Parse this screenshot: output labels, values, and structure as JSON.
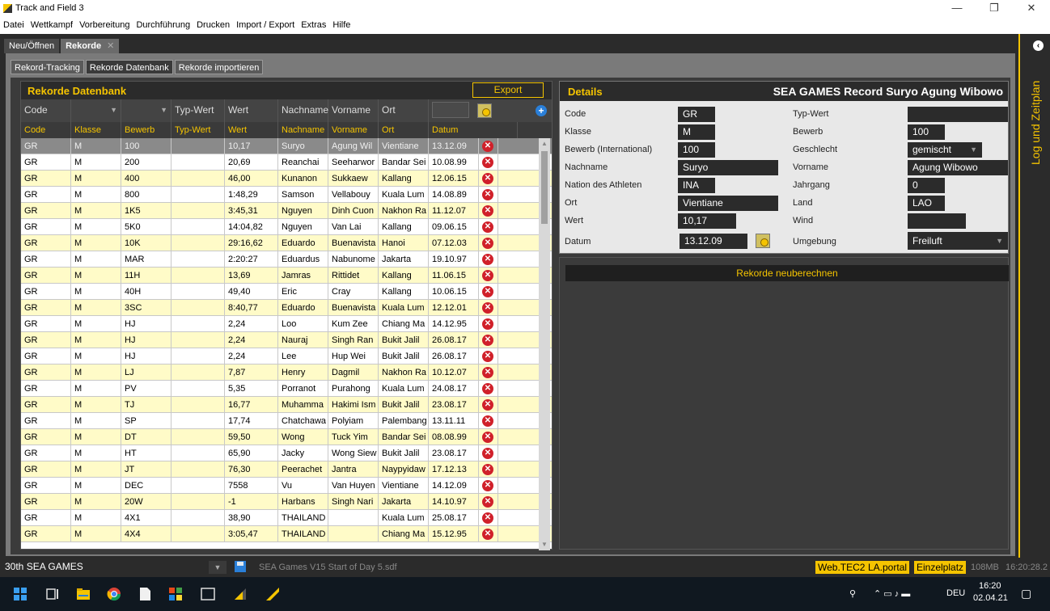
{
  "window": {
    "title": "Track and Field 3",
    "minimize": "—",
    "maximize": "❐",
    "close": "✕"
  },
  "menu": [
    "Datei",
    "Wettkampf",
    "Vorbereitung",
    "Durchführung",
    "Drucken",
    "Import / Export",
    "Extras",
    "Hilfe"
  ],
  "doc_tabs": {
    "open": "Neu/Öffnen",
    "records": "Rekorde",
    "close_glyph": "✕"
  },
  "side_panel": {
    "label": "Log und Zeitplan",
    "collapse_glyph": "‹"
  },
  "sub_tabs": [
    "Rekord-Tracking",
    "Rekorde Datenbank",
    "Rekorde importieren"
  ],
  "db": {
    "title": "Rekorde Datenbank",
    "export_label": "Export",
    "filters": {
      "code": "Code",
      "typ_wert": "Typ-Wert",
      "wert": "Wert",
      "nachname": "Nachname",
      "vorname": "Vorname",
      "ort": "Ort",
      "add_glyph": "+"
    },
    "columns": [
      "Code",
      "Klasse",
      "Bewerb",
      "Typ-Wert",
      "Wert",
      "Nachname",
      "Vorname",
      "Ort",
      "Datum"
    ],
    "rows": [
      [
        "GR",
        "M",
        "100",
        "",
        "10,17",
        "Suryo",
        "Agung Wil",
        "Vientiane",
        "13.12.09"
      ],
      [
        "GR",
        "M",
        "200",
        "",
        "20,69",
        "Reanchai",
        "Seeharwor",
        "Bandar Sei",
        "10.08.99"
      ],
      [
        "GR",
        "M",
        "400",
        "",
        "46,00",
        "Kunanon",
        "Sukkaew",
        "Kallang",
        "12.06.15"
      ],
      [
        "GR",
        "M",
        "800",
        "",
        "1:48,29",
        "Samson",
        "Vellabouy",
        "Kuala Lum",
        "14.08.89"
      ],
      [
        "GR",
        "M",
        "1K5",
        "",
        "3:45,31",
        "Nguyen",
        "Dinh Cuon",
        "Nakhon Ra",
        "11.12.07"
      ],
      [
        "GR",
        "M",
        "5K0",
        "",
        "14:04,82",
        "Nguyen",
        "Van Lai",
        "Kallang",
        "09.06.15"
      ],
      [
        "GR",
        "M",
        "10K",
        "",
        "29:16,62",
        "Eduardo",
        "Buenavista",
        "Hanoi",
        "07.12.03"
      ],
      [
        "GR",
        "M",
        "MAR",
        "",
        "2:20:27",
        "Eduardus",
        "Nabunome",
        "Jakarta",
        "19.10.97"
      ],
      [
        "GR",
        "M",
        "11H",
        "",
        "13,69",
        "Jamras",
        "Rittidet",
        "Kallang",
        "11.06.15"
      ],
      [
        "GR",
        "M",
        "40H",
        "",
        "49,40",
        "Eric",
        "Cray",
        "Kallang",
        "10.06.15"
      ],
      [
        "GR",
        "M",
        "3SC",
        "",
        "8:40,77",
        "Eduardo",
        "Buenavista",
        "Kuala Lum",
        "12.12.01"
      ],
      [
        "GR",
        "M",
        "HJ",
        "",
        "2,24",
        "Loo",
        "Kum Zee",
        "Chiang Ma",
        "14.12.95"
      ],
      [
        "GR",
        "M",
        "HJ",
        "",
        "2,24",
        "Nauraj",
        "Singh Ran",
        "Bukit Jalil",
        "26.08.17"
      ],
      [
        "GR",
        "M",
        "HJ",
        "",
        "2,24",
        "Lee",
        "Hup Wei",
        "Bukit Jalil",
        "26.08.17"
      ],
      [
        "GR",
        "M",
        "LJ",
        "",
        "7,87",
        "Henry",
        "Dagmil",
        "Nakhon Ra",
        "10.12.07"
      ],
      [
        "GR",
        "M",
        "PV",
        "",
        "5,35",
        "Porranot",
        "Purahong",
        "Kuala Lum",
        "24.08.17"
      ],
      [
        "GR",
        "M",
        "TJ",
        "",
        "16,77",
        "Muhamma",
        "Hakimi Ism",
        "Bukit Jalil",
        "23.08.17"
      ],
      [
        "GR",
        "M",
        "SP",
        "",
        "17,74",
        "Chatchawa",
        "Polyiam",
        "Palembang",
        "13.11.11"
      ],
      [
        "GR",
        "M",
        "DT",
        "",
        "59,50",
        "Wong",
        "Tuck Yim",
        "Bandar Sei",
        "08.08.99"
      ],
      [
        "GR",
        "M",
        "HT",
        "",
        "65,90",
        "Jacky",
        "Wong Siew",
        "Bukit Jalil",
        "23.08.17"
      ],
      [
        "GR",
        "M",
        "JT",
        "",
        "76,30",
        "Peerachet",
        "Jantra",
        "Naypyidaw",
        "17.12.13"
      ],
      [
        "GR",
        "M",
        "DEC",
        "",
        "7558",
        "Vu",
        "Van Huyen",
        "Vientiane",
        "14.12.09"
      ],
      [
        "GR",
        "M",
        "20W",
        "",
        "-1",
        "Harbans",
        "Singh Nari",
        "Jakarta",
        "14.10.97"
      ],
      [
        "GR",
        "M",
        "4X1",
        "",
        "38,90",
        "THAILAND",
        "",
        "Kuala Lum",
        "25.08.17"
      ],
      [
        "GR",
        "M",
        "4X4",
        "",
        "3:05,47",
        "THAILAND",
        "",
        "Chiang Ma",
        "15.12.95"
      ]
    ]
  },
  "details": {
    "title": "Details",
    "record_title": "SEA GAMES Record Suryo Agung Wibowo",
    "labels": {
      "code": "Code",
      "typ_wert": "Typ-Wert",
      "klasse": "Klasse",
      "bewerb": "Bewerb",
      "bewerb_int": "Bewerb (International)",
      "geschlecht": "Geschlecht",
      "nachname": "Nachname",
      "vorname": "Vorname",
      "nation": "Nation des Athleten",
      "jahrgang": "Jahrgang",
      "ort": "Ort",
      "land": "Land",
      "wert": "Wert",
      "wind": "Wind",
      "datum": "Datum",
      "umgebung": "Umgebung"
    },
    "values": {
      "code": "GR",
      "typ_wert": "",
      "klasse": "M",
      "bewerb": "100",
      "bewerb_int": "100",
      "geschlecht": "gemischt",
      "nachname": "Suryo",
      "vorname": "Agung Wibowo",
      "nation": "INA",
      "jahrgang": "0",
      "ort": "Vientiane",
      "land": "LAO",
      "wert": "10,17",
      "wind": "",
      "datum": "13.12.09",
      "umgebung": "Freiluft"
    },
    "recalc_label": "Rekorde neuberechnen"
  },
  "statusbar": {
    "event": "30th SEA GAMES",
    "file": "SEA Games V15 Start of Day 5.sdf",
    "badges": [
      "Web.TEC2",
      "LA.portal",
      "Einzelplatz"
    ],
    "memory": "108MB",
    "time": "16:20:28.2"
  },
  "taskbar": {
    "lang": "DEU",
    "time": "16:20",
    "date": "02.04.21"
  },
  "colors": {
    "accent": "#f5c400",
    "row_alt": "#fffbc8",
    "delete": "#d0202a"
  }
}
